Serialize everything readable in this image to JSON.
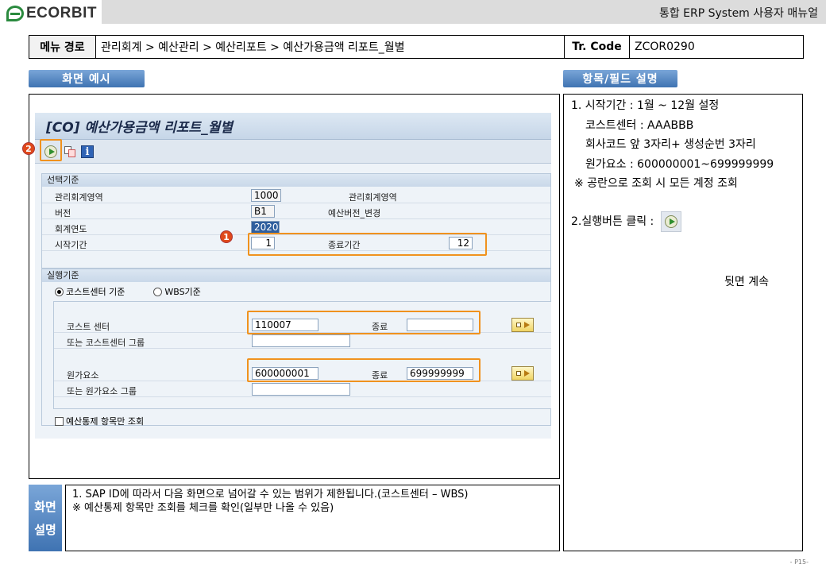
{
  "header": {
    "logo_text": "ECORBIT",
    "manual_title": "통합 ERP System 사용자 매뉴얼"
  },
  "path_row": {
    "menu_label": "메뉴 경로",
    "menu_path": "관리회계 > 예산관리 > 예산리포트 > 예산가용금액 리포트_월별",
    "tcode_label": "Tr. Code",
    "tcode": "ZCOR0290"
  },
  "tabs": {
    "screen_example": "화면 예시",
    "field_desc": "항목/필드 설명"
  },
  "sap": {
    "title": "[CO] 예산가용금액 리포트_월별",
    "selection_group": {
      "header": "선택기준",
      "rows": [
        {
          "label": "관리회계영역",
          "value": "1000",
          "side_label": "관리회계영역"
        },
        {
          "label": "버전",
          "value": "B1",
          "side_label": "예산버전_변경"
        },
        {
          "label": "회계연도",
          "value": "2020"
        },
        {
          "label": "시작기간",
          "value": "1",
          "end_label": "종료기간",
          "end_value": "12"
        }
      ]
    },
    "exec_group": {
      "header": "실행기준",
      "radio_cost": "코스트센터 기준",
      "radio_wbs": "WBS기준",
      "cost_center_label": "코스트 센터",
      "cost_center_from": "110007",
      "cost_center_to_label": "종료",
      "cost_center_to": "",
      "cost_center_group_label": "또는 코스트센터 그룹",
      "cost_center_group": "",
      "cost_element_label": "원가요소",
      "cost_element_from": "600000001",
      "cost_element_to_label": "종료",
      "cost_element_to": "699999999",
      "cost_element_group_label": "또는 원가요소 그룹",
      "cost_element_group": "",
      "checkbox_label": "예산통제 항목만 조회"
    },
    "badges": {
      "one": "1",
      "two": "2"
    }
  },
  "description": {
    "lines": [
      "1. 시작기간 : 1월 ~ 12월 설정",
      "코스트센터 : AAABBB",
      "회사코드 앞 3자리+ 생성순번 3자리",
      "원가요소 : 600000001~699999999",
      "※ 공란으로 조회 시 모든 계정 조회",
      "2.실행버튼 클릭 :"
    ],
    "continue": "뒷면 계속"
  },
  "screen_desc": {
    "tab_line1": "화면",
    "tab_line2": "설명",
    "line1": "1.   SAP ID에 따라서 다음 화면으로 넘어갈 수 있는 범위가 제한됩니다.(코스트센터 – WBS)",
    "line2": "※ 예산통제 항목만 조회를 체크를 확인(일부만 나올 수 있음)"
  },
  "page_no": "- P15-",
  "colors": {
    "highlight": "#f0921e",
    "badge": "#e0491b",
    "tab_blue": "#3f73b2",
    "logo_green": "#2a8a3e"
  }
}
